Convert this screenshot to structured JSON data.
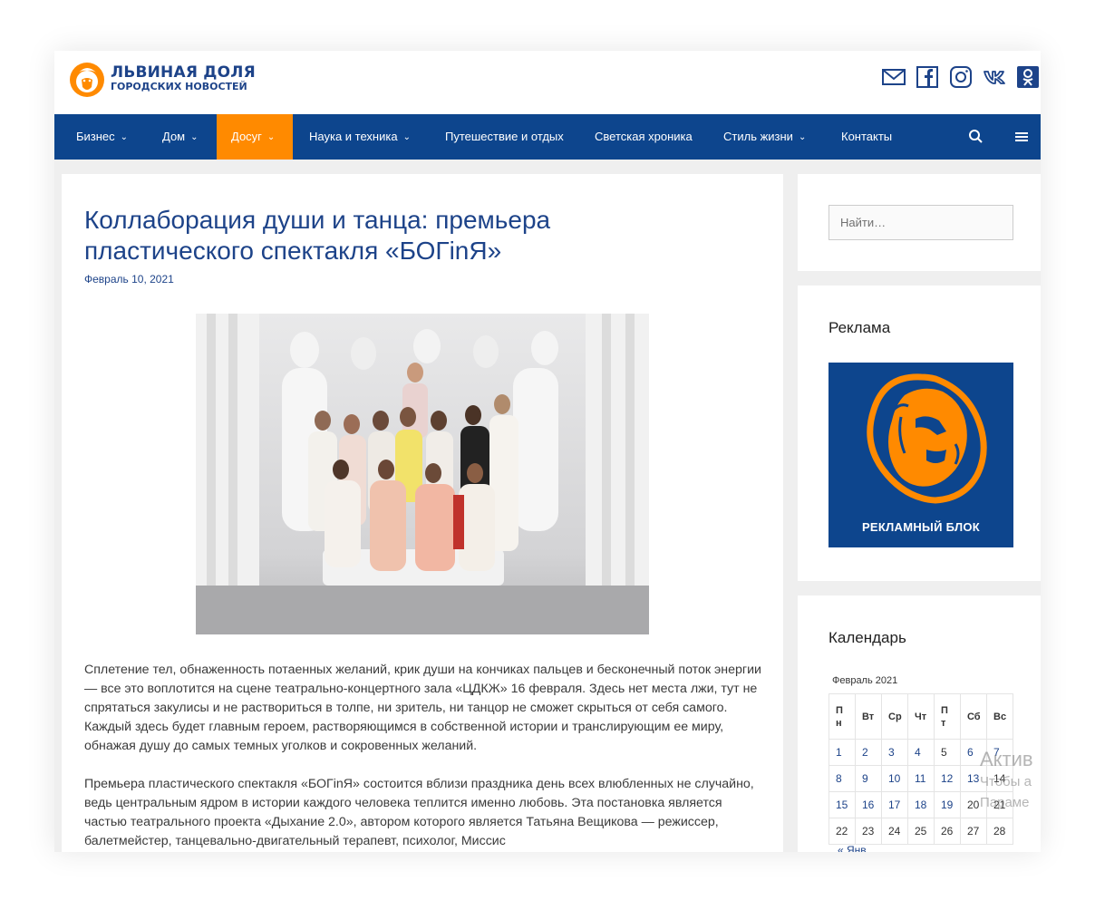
{
  "header": {
    "logo_title": "ЛЬВИНАЯ ДОЛЯ",
    "logo_subtitle": "ГОРОДСКИХ НОВОСТЕЙ",
    "social": [
      "mail-icon",
      "facebook-icon",
      "instagram-icon",
      "vk-icon",
      "odnoklassniki-icon"
    ]
  },
  "nav": {
    "items": [
      {
        "label": "Бизнес",
        "dropdown": true
      },
      {
        "label": "Дом",
        "dropdown": true
      },
      {
        "label": "Досуг",
        "dropdown": true,
        "active": true
      },
      {
        "label": "Наука и техника",
        "dropdown": true
      },
      {
        "label": "Путешествие и отдых",
        "dropdown": false
      },
      {
        "label": "Светская хроника",
        "dropdown": false
      },
      {
        "label": "Стиль жизни",
        "dropdown": true
      },
      {
        "label": "Контакты",
        "dropdown": false
      }
    ],
    "chevron": "⌄",
    "icons": [
      "search-icon",
      "menu-icon"
    ]
  },
  "article": {
    "title": "Коллаборация души и танца: премьера пластического спектакля «БОГinЯ»",
    "date": "Февраль 10, 2021",
    "paragraphs": [
      "Сплетение тел, обнаженность потаенных желаний, крик души на кончиках пальцев и бесконечный поток энергии — все это воплотится на сцене театрально-концертного зала «ЦДКЖ» 16 февраля. Здесь нет места лжи, тут не спрятаться закулисы и не раствориться в толпе, ни зритель, ни танцор не сможет скрыться от себя самого. Каждый здесь будет главным героем, растворяющимся в собственной истории и транслирующим ее миру, обнажая душу до самых темных уголков и сокровенных желаний.",
      "Премьера пластического спектакля «БОГinЯ» состоится вблизи праздника день всех влюбленных не случайно, ведь центральным ядром в истории каждого человека теплится именно любовь. Эта постановка является частью театрального проекта «Дыхание 2.0», автором которого является Татьяна Вещикова — режиссер, балетмейстер, танцевально-двигательный терапевт, психолог, Миссис"
    ]
  },
  "sidebar": {
    "search_placeholder": "Найти…",
    "ad_title": "Реклама",
    "ad_label": "РЕКЛАМНЫЙ БЛОК",
    "calendar_title": "Календарь",
    "calendar": {
      "caption": "Февраль 2021",
      "weekdays": [
        "П\nн",
        "Вт",
        "Ср",
        "Чт",
        "П\nт",
        "Сб",
        "Вс"
      ],
      "rows": [
        [
          "1",
          "2",
          "3",
          "4",
          "5",
          "6",
          "7"
        ],
        [
          "8",
          "9",
          "10",
          "11",
          "12",
          "13",
          "14"
        ],
        [
          "15",
          "16",
          "17",
          "18",
          "19",
          "20",
          "21"
        ],
        [
          "22",
          "23",
          "24",
          "25",
          "26",
          "27",
          "28"
        ]
      ],
      "linked_days": [
        "1",
        "2",
        "3",
        "4",
        "6",
        "7",
        "8",
        "9",
        "10",
        "11",
        "12",
        "13",
        "15",
        "16",
        "17",
        "18",
        "19"
      ],
      "prev_link": "« Янв"
    }
  },
  "watermark": {
    "line1": "Актив",
    "line2": "Чтобы а",
    "line3": "Параме"
  },
  "colors": {
    "brand_blue": "#0d458d",
    "accent_orange": "#ff8a00",
    "title_blue": "#1d4389"
  }
}
